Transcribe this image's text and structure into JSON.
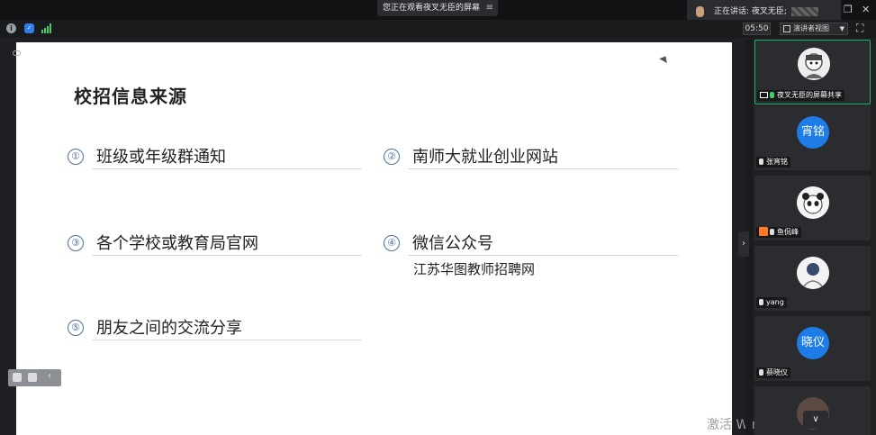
{
  "banner": {
    "watching": "您正在观看夜叉无臣的屏幕",
    "menu_icon": "≡"
  },
  "speaking": {
    "label": "正在讲话: 夜叉无臣;"
  },
  "window_controls": {
    "restore": "❐",
    "close": "✕"
  },
  "toolbar": {
    "timer": "05:50",
    "view_mode": "演讲者视图"
  },
  "slide": {
    "title": "校招信息来源",
    "items": [
      {
        "num": "①",
        "label": "班级或年级群通知"
      },
      {
        "num": "②",
        "label": "南师大就业创业网站"
      },
      {
        "num": "③",
        "label": "各个学校或教育局官网"
      },
      {
        "num": "④",
        "label": "微信公众号"
      },
      {
        "num": "⑤",
        "label": "朋友之间的交流分享"
      }
    ],
    "sub_label": "江苏华图教师招聘网"
  },
  "watermark": "激活 Windows",
  "participants": [
    {
      "name": "夜叉无臣的屏幕共享",
      "avatar": "cartoon-portrait",
      "mic_on": true,
      "sharing": true,
      "active": true
    },
    {
      "name": "张宵铭",
      "avatar_text": "宵铭",
      "mic_on": false
    },
    {
      "name": "鱼侃峰",
      "avatar": "panda",
      "mic_on": false,
      "host_badge": true
    },
    {
      "name": "yang",
      "avatar": "sketch",
      "mic_on": false
    },
    {
      "name": "蔡晓仪",
      "avatar_text": "晓仪",
      "mic_on": false
    },
    {
      "name": "",
      "avatar": "dark-photo",
      "mic_on": false
    }
  ],
  "colors": {
    "accent": "#1fb36b",
    "avatar_blue": "#1e7ce8",
    "number_circle": "#4b6f9e"
  }
}
